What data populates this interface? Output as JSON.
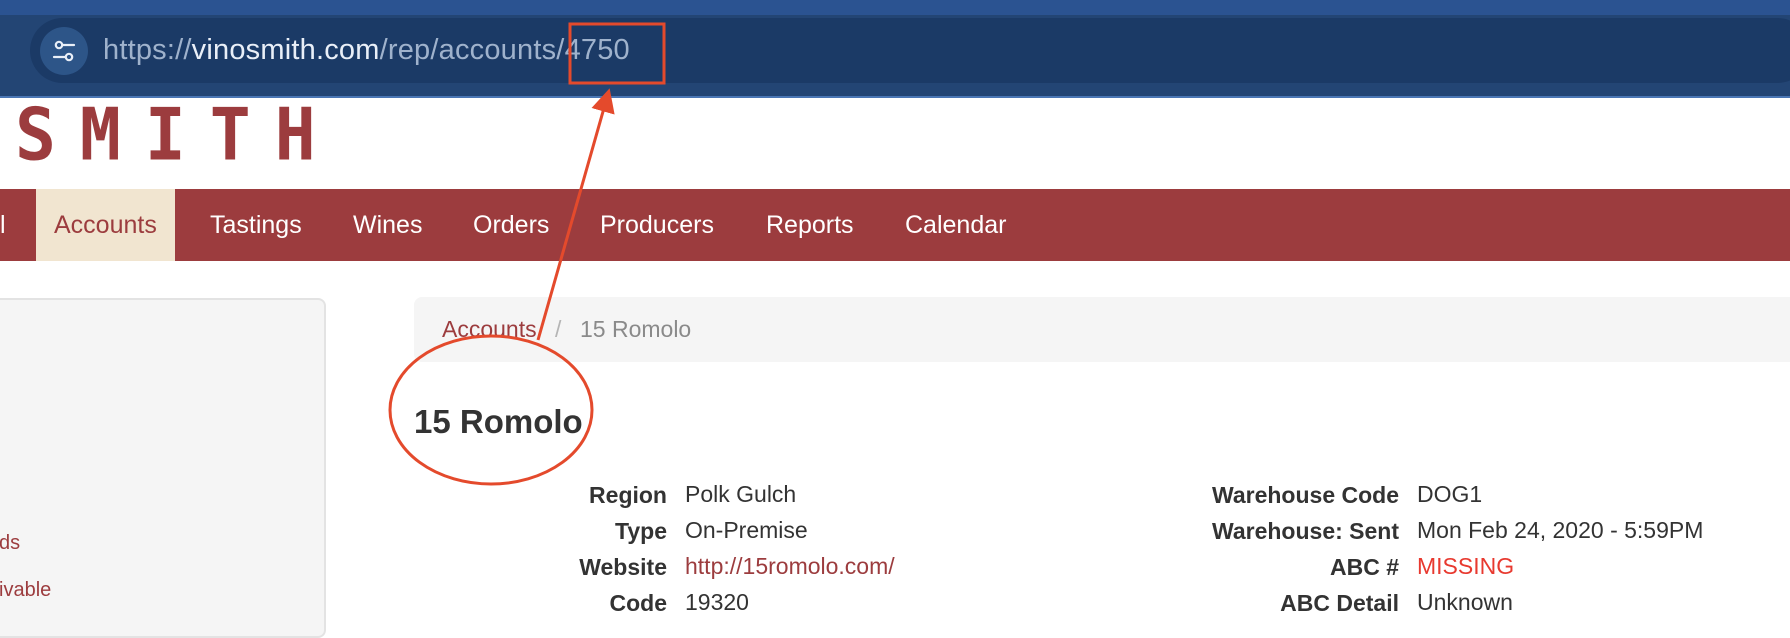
{
  "browser": {
    "url_scheme": "https://",
    "url_host": "vinosmith.com",
    "url_path": "/rep/accounts",
    "url_slash": "/",
    "url_id": "4750",
    "settings_icon": "tune-icon"
  },
  "logo": {
    "text": "OSMITH"
  },
  "nav": {
    "edge_label": "l",
    "items": [
      {
        "label": "Accounts"
      },
      {
        "label": "Tastings"
      },
      {
        "label": "Wines"
      },
      {
        "label": "Orders"
      },
      {
        "label": "Producers"
      },
      {
        "label": "Reports"
      },
      {
        "label": "Calendar"
      }
    ],
    "active_index": 0
  },
  "sidebar": {
    "links": [
      {
        "label": "ds"
      },
      {
        "label": "ivable"
      }
    ]
  },
  "breadcrumb": {
    "parent": "Accounts",
    "separator": "/",
    "current": "15 Romolo"
  },
  "account": {
    "title": "15 Romolo",
    "left": [
      {
        "label": "Region",
        "value": "Polk Gulch"
      },
      {
        "label": "Type",
        "value": "On-Premise"
      },
      {
        "label": "Website",
        "value": "http://15romolo.com/"
      },
      {
        "label": "Code",
        "value": "19320"
      }
    ],
    "right": [
      {
        "label": "Warehouse Code",
        "value": "DOG1"
      },
      {
        "label": "Warehouse: Sent",
        "value": "Mon Feb 24, 2020 - 5:59PM"
      },
      {
        "label": "ABC #",
        "value": "MISSING"
      },
      {
        "label": "ABC Detail",
        "value": "Unknown"
      }
    ]
  },
  "colors": {
    "brand": "#9c3c3e",
    "active_tab_bg": "#f1e5d0",
    "browser_bar": "#234574",
    "annotation": "#e44a2c",
    "missing": "#e8392f"
  }
}
